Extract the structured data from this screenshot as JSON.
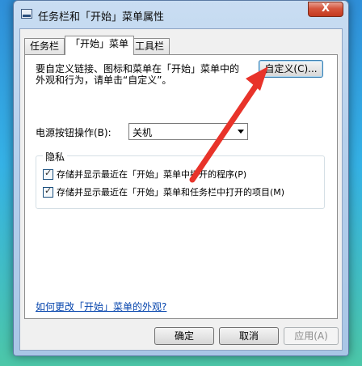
{
  "window": {
    "title": "任务栏和「开始」菜单属性",
    "close_label": "X"
  },
  "tabs": [
    {
      "label": "任务栏",
      "active": false
    },
    {
      "label": "「开始」菜单",
      "active": true
    },
    {
      "label": "工具栏",
      "active": false
    }
  ],
  "start_menu": {
    "description_line1": "要自定义链接、图标和菜单在「开始」菜单中的",
    "description_line2": "外观和行为，请单击“自定义”。",
    "customize_button": "自定义(C)...",
    "power_button_label": "电源按钮操作(B):",
    "power_button_value": "关机",
    "privacy_group_title": "隐私",
    "privacy_options": [
      {
        "label": "存储并显示最近在「开始」菜单中打开的程序(P)",
        "checked": true
      },
      {
        "label": "存储并显示最近在「开始」菜单和任务栏中打开的项目(M)",
        "checked": true
      }
    ],
    "help_link": "如何更改「开始」菜单的外观?"
  },
  "footer": {
    "ok_button": "确定",
    "cancel_button": "取消",
    "apply_button": "应用(A)"
  },
  "annotation": {
    "arrow_color": "#e8332a"
  }
}
